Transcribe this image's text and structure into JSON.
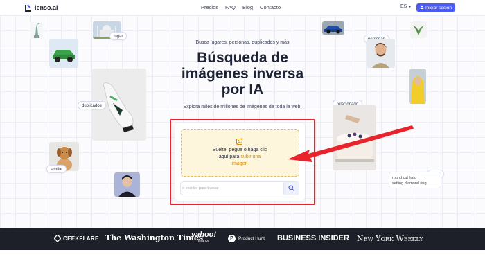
{
  "header": {
    "logo": "lenso.ai",
    "nav": [
      "Precios",
      "FAQ",
      "Blog",
      "Contacto"
    ],
    "language": "ES",
    "login_label": "Iniciar sesión"
  },
  "hero": {
    "eyebrow": "Busca lugares, personas, duplicados y más",
    "title_lines": [
      "Búsqueda de",
      "imágenes inversa",
      "por IA"
    ],
    "subtitle": "Explora miles de millones de imágenes de toda la web."
  },
  "upload": {
    "text_line1": "Suelte, pegue o haga clic",
    "text_line2_prefix": "aquí para",
    "link_text_1": "subir una",
    "link_text_2": "imagen"
  },
  "search": {
    "placeholder": "o escribe para buscar"
  },
  "tags": {
    "lugar": "lugar",
    "personas": "personas",
    "duplicados": "duplicados",
    "relacionado": "relacionado",
    "similar": "similar",
    "texto": "texto"
  },
  "texto_card": {
    "line1": "round cut halo",
    "line2": "setting diamond ring"
  },
  "logos": [
    "CEEKFLARE",
    "The Washington Times",
    "yahoo!",
    "finance",
    "Product Hunt",
    "BUSINESS INSIDER",
    "New York Weekly"
  ],
  "colors": {
    "accent": "#4a5cf5",
    "highlight_frame": "#e8232b",
    "dropzone_bg": "#fdf6dd",
    "link": "#d98a00",
    "band": "#1e2029"
  }
}
